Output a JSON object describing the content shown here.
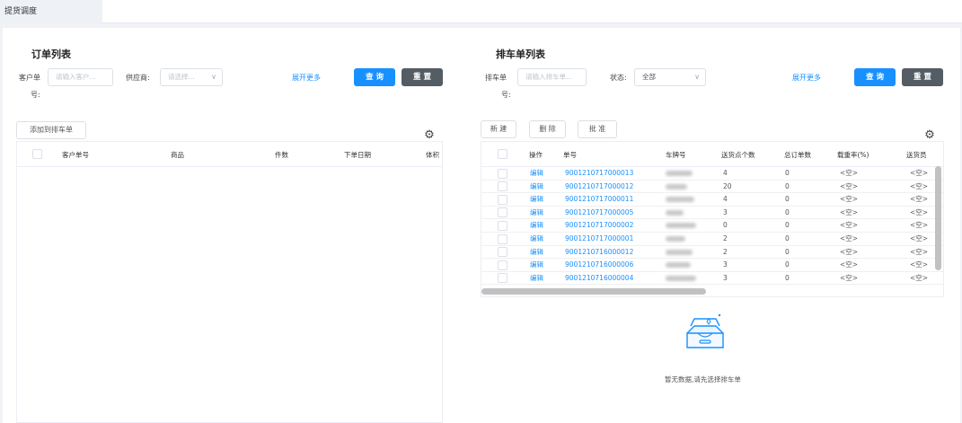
{
  "tab": {
    "label": "提货调度"
  },
  "left": {
    "title": "订单列表",
    "customer_label_1": "客户单",
    "customer_label_2": "号:",
    "customer_placeholder": "请输入客户...",
    "supplier_label": "供应商:",
    "supplier_placeholder": "请选择...",
    "expand": "展开更多",
    "query": "查 询",
    "reset": "重 置",
    "add_button": "添加到排车单",
    "columns": [
      "客户单号",
      "商品",
      "件数",
      "下单日期",
      "体积"
    ]
  },
  "right": {
    "title": "排车单列表",
    "dispatch_label_1": "排车单",
    "dispatch_label_2": "号:",
    "dispatch_placeholder": "请输入排车单...",
    "status_label": "状态:",
    "status_value": "全部",
    "expand": "展开更多",
    "query": "查 询",
    "reset": "重 置",
    "new": "新 建",
    "delete": "删 除",
    "approve": "批 准",
    "columns": [
      "操作",
      "单号",
      "车牌号",
      "送货点个数",
      "总订单数",
      "载重率(%)",
      "送货员"
    ],
    "rows": [
      {
        "op": "编辑",
        "no": "9001210717000013",
        "points": "4",
        "orders": "0",
        "load": "<空>",
        "driver": "<空>"
      },
      {
        "op": "编辑",
        "no": "9001210717000012",
        "points": "20",
        "orders": "0",
        "load": "<空>",
        "driver": "<空>"
      },
      {
        "op": "编辑",
        "no": "9001210717000011",
        "points": "4",
        "orders": "0",
        "load": "<空>",
        "driver": "<空>"
      },
      {
        "op": "编辑",
        "no": "9001210717000005",
        "points": "3",
        "orders": "0",
        "load": "<空>",
        "driver": "<空>"
      },
      {
        "op": "编辑",
        "no": "9001210717000002",
        "points": "0",
        "orders": "0",
        "load": "<空>",
        "driver": "<空>"
      },
      {
        "op": "编辑",
        "no": "9001210717000001",
        "points": "2",
        "orders": "0",
        "load": "<空>",
        "driver": "<空>"
      },
      {
        "op": "编辑",
        "no": "9001210716000012",
        "points": "2",
        "orders": "0",
        "load": "<空>",
        "driver": "<空>"
      },
      {
        "op": "编辑",
        "no": "9001210716000006",
        "points": "3",
        "orders": "0",
        "load": "<空>",
        "driver": "<空>"
      },
      {
        "op": "编辑",
        "no": "9001210716000004",
        "points": "3",
        "orders": "0",
        "load": "<空>",
        "driver": "<空>"
      }
    ],
    "empty_text": "暂无数据,请先选择排车单"
  }
}
